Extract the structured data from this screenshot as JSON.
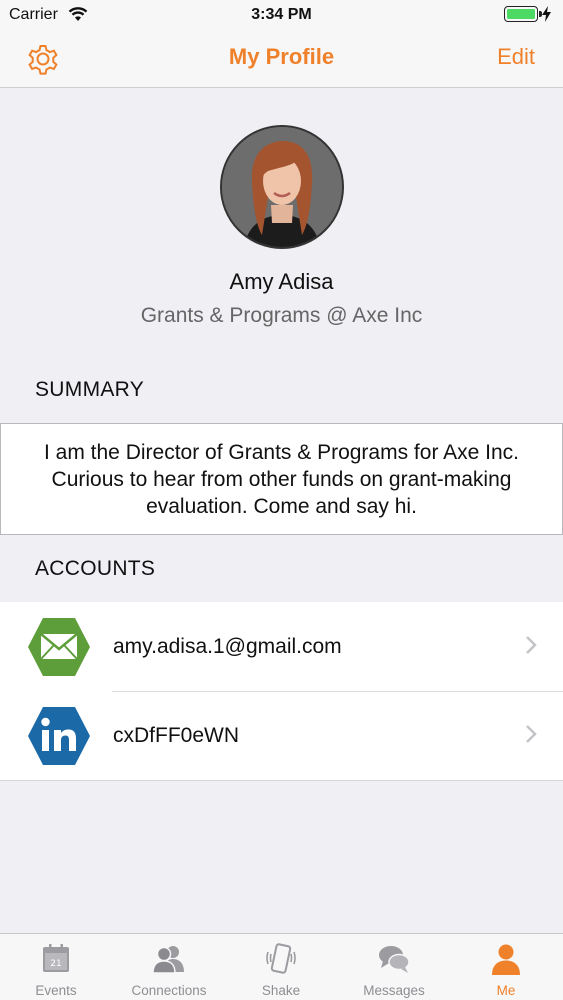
{
  "status_bar": {
    "carrier": "Carrier",
    "time": "3:34 PM",
    "battery_level": 1.0
  },
  "nav": {
    "title": "My Profile",
    "edit_label": "Edit",
    "settings_icon": "gear-icon"
  },
  "profile": {
    "name": "Amy Adisa",
    "title": "Grants & Programs @ Axe Inc"
  },
  "summary": {
    "header": "SUMMARY",
    "text": "I am the Director of Grants & Programs for Axe Inc. Curious to hear from other funds on grant-making evaluation. Come and say hi."
  },
  "accounts": {
    "header": "ACCOUNTS",
    "items": [
      {
        "label": "amy.adisa.1@gmail.com",
        "icon": "email-icon"
      },
      {
        "label": "cxDfFF0eWN",
        "icon": "linkedin-icon"
      }
    ]
  },
  "tabs": [
    {
      "label": "Events",
      "icon": "calendar-icon",
      "badge": "21"
    },
    {
      "label": "Connections",
      "icon": "connections-icon"
    },
    {
      "label": "Shake",
      "icon": "shake-phone-icon"
    },
    {
      "label": "Messages",
      "icon": "messages-icon"
    },
    {
      "label": "Me",
      "icon": "person-icon",
      "active": true
    }
  ],
  "colors": {
    "accent": "#f0812b",
    "email_green": "#5e9e3a",
    "linkedin_blue": "#1c69a8",
    "tab_inactive": "#8e8e93"
  }
}
